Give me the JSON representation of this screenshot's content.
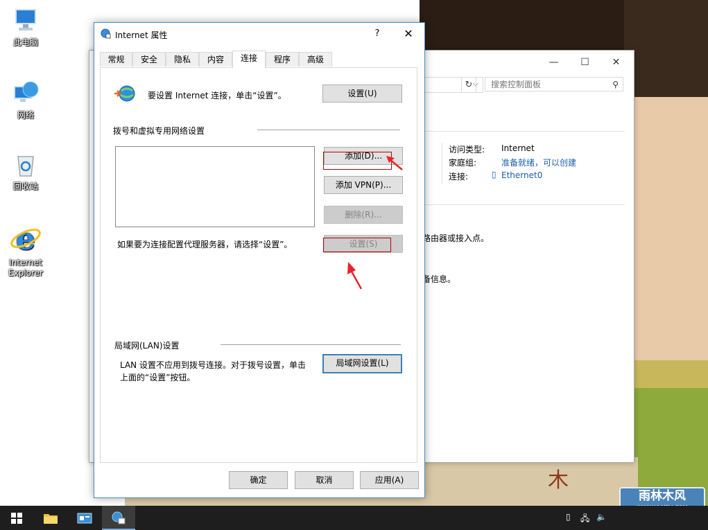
{
  "desktop": {
    "icons": [
      {
        "label": "此电脑"
      },
      {
        "label": "网络"
      },
      {
        "label": "回收站"
      },
      {
        "label": "Internet Explorer"
      }
    ]
  },
  "wallpaper": {
    "logo_text": "木",
    "watermark_title": "雨林木风",
    "watermark_url": "WWW.YLMFU.COM"
  },
  "control_panel": {
    "search_placeholder": "搜索控制面板",
    "access_type_label": "访问类型:",
    "access_type_value": "Internet",
    "homegroup_label": "家庭组:",
    "homegroup_value": "准备就绪，可以创建",
    "connection_label": "连接:",
    "connection_value": "Ethernet0",
    "partial_text_1": "路由器或接入点。",
    "partial_text_2": "备信息。"
  },
  "dialog": {
    "title": "Internet 属性",
    "help_label": "?",
    "close_label": "✕",
    "tabs": [
      {
        "label": "常规"
      },
      {
        "label": "安全"
      },
      {
        "label": "隐私"
      },
      {
        "label": "内容"
      },
      {
        "label": "连接",
        "active": true
      },
      {
        "label": "程序"
      },
      {
        "label": "高级"
      }
    ],
    "setup_text": "要设置 Internet 连接，单击“设置”。",
    "setup_button": "设置(U)",
    "dialup_group": "拨号和虚拟专用网络设置",
    "add_button": "添加(D)...",
    "add_vpn_button": "添加 VPN(P)...",
    "remove_button": "删除(R)...",
    "proxy_text": "如果要为连接配置代理服务器，请选择“设置”。",
    "proxy_settings_button": "设置(S)",
    "lan_group": "局域网(LAN)设置",
    "lan_text_line1": "LAN 设置不应用到拨号连接。对于拨号设置，单击",
    "lan_text_line2": "上面的“设置”按钮。",
    "lan_button": "局域网设置(L)",
    "ok_button": "确定",
    "cancel_button": "取消",
    "apply_button": "应用(A)"
  },
  "colors": {
    "accent": "#3c7fb1",
    "annotation_red": "#b40000",
    "link": "#1a5fa8"
  }
}
